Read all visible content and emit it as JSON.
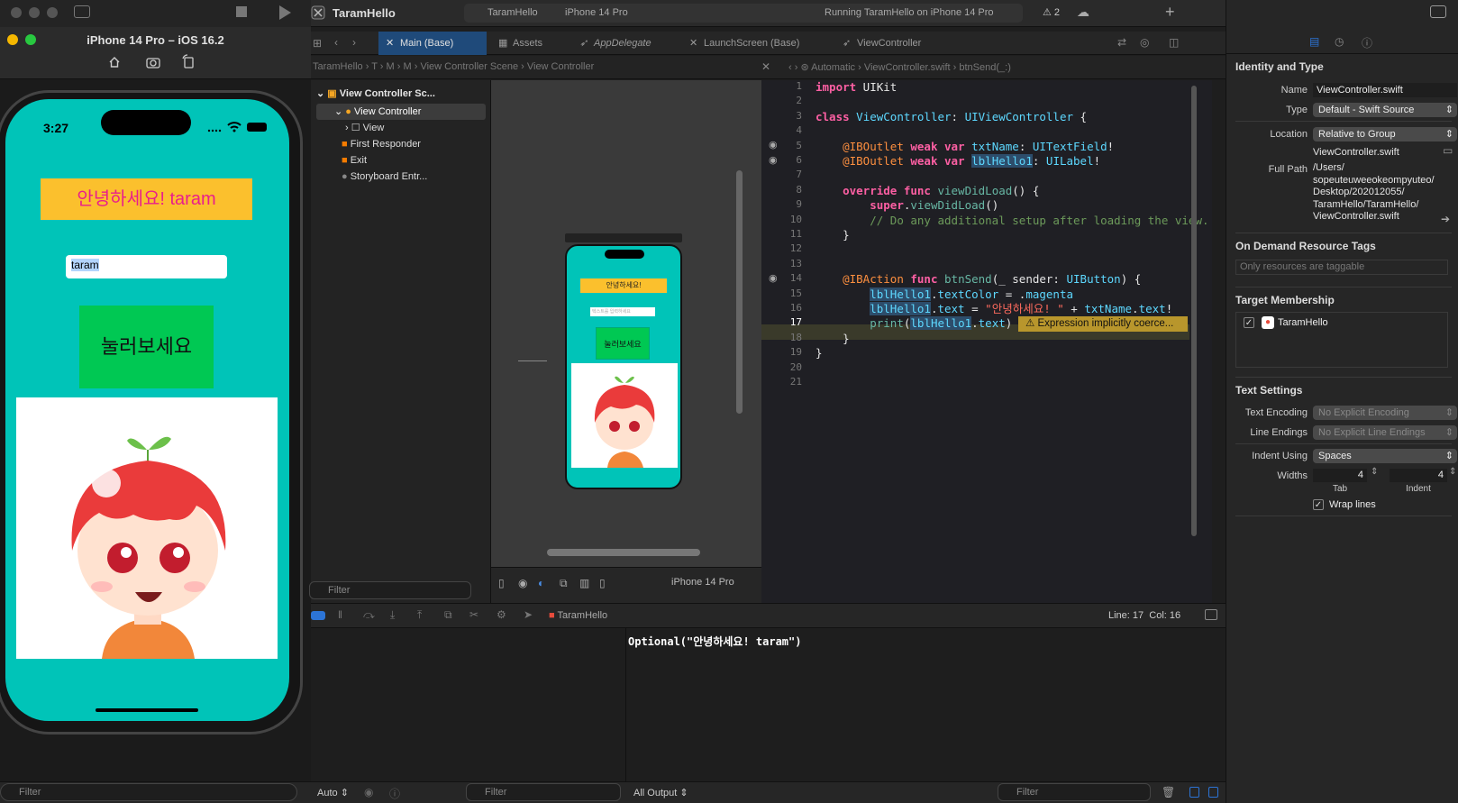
{
  "simulator": {
    "title": "iPhone 14 Pro – iOS 16.2",
    "time": "3:27",
    "greeting": "안녕하세요! taram",
    "text_field_value": "taram",
    "button_label": "눌러보세요",
    "filter_placeholder": "Filter"
  },
  "toolbar": {
    "project": "TaramHello",
    "scheme": "TaramHello",
    "device": "iPhone 14 Pro",
    "status": "Running TaramHello on iPhone 14 Pro",
    "warnings": "2"
  },
  "tabs": [
    "Main (Base)",
    "Assets",
    "AppDelegate",
    "LaunchScreen (Base)",
    "ViewController"
  ],
  "jump_left": [
    "TaramHello",
    "T",
    "M",
    "M",
    "View Controller Scene",
    "View Controller"
  ],
  "jump_right": [
    "Automatic",
    "ViewController.swift",
    "btnSend(_:)"
  ],
  "outline": {
    "items": [
      "View Controller Sc...",
      "View Controller",
      "View",
      "First Responder",
      "Exit",
      "Storyboard Entr..."
    ],
    "filter_placeholder": "Filter"
  },
  "canvas": {
    "greeting": "안녕하세요!",
    "field_placeholder": "텍스트를 입력하세요",
    "button": "눌러보세요",
    "device_label": "iPhone 14 Pro"
  },
  "editor": {
    "line_numbers": [
      "1",
      "2",
      "3",
      "4",
      "5",
      "6",
      "7",
      "8",
      "9",
      "10",
      "11",
      "12",
      "13",
      "14",
      "15",
      "16",
      "17",
      "18",
      "19",
      "20",
      "21"
    ],
    "warning_text": "Expression implicitly coerce..."
  },
  "debug": {
    "app": "TaramHello",
    "position": "Line: 17  Col: 16",
    "console_output": "Optional(\"안녕하세요! taram\")"
  },
  "bottom": {
    "auto": "Auto",
    "filter": "Filter",
    "all_output": "All Output"
  },
  "inspector": {
    "identity_title": "Identity and Type",
    "name_label": "Name",
    "name_value": "ViewController.swift",
    "type_label": "Type",
    "type_value": "Default - Swift Source",
    "location_label": "Location",
    "location_value": "Relative to Group",
    "location_file": "ViewController.swift",
    "full_path_label": "Full Path",
    "full_path": [
      "/Users/",
      "sopeuteuweeokeompyuteo/",
      "Desktop/202012055/",
      "TaramHello/TaramHello/",
      "ViewController.swift"
    ],
    "odr_title": "On Demand Resource Tags",
    "odr_placeholder": "Only resources are taggable",
    "target_title": "Target Membership",
    "target_name": "TaramHello",
    "text_settings_title": "Text Settings",
    "encoding_label": "Text Encoding",
    "encoding_value": "No Explicit Encoding",
    "endings_label": "Line Endings",
    "endings_value": "No Explicit Line Endings",
    "indent_label": "Indent Using",
    "indent_value": "Spaces",
    "widths_label": "Widths",
    "tab_width": "4",
    "indent_width": "4",
    "tab_caption": "Tab",
    "indent_caption": "Indent",
    "wrap_label": "Wrap lines"
  },
  "colors": {
    "app_bg": "#00c4b8",
    "label_bg": "#fbc02d",
    "label_text": "#e91e8c",
    "button_bg": "#00c853",
    "warning": "#b8962c"
  }
}
